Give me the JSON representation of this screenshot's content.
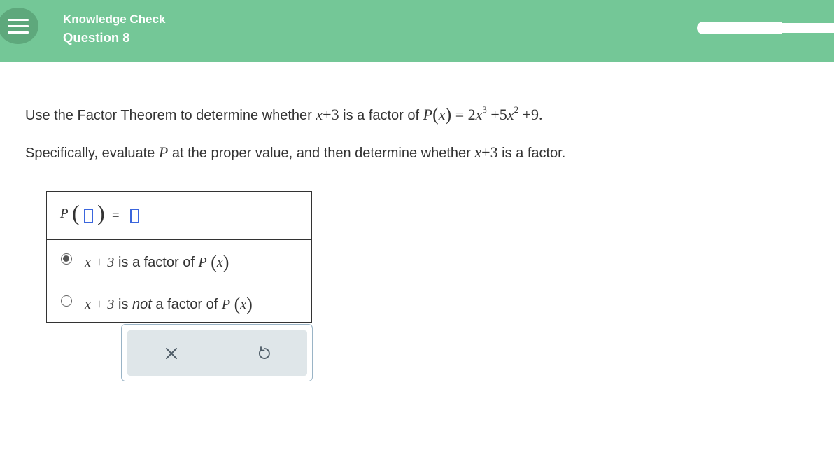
{
  "header": {
    "section": "Knowledge Check",
    "question": "Question 8",
    "menu_icon": "hamburger-icon",
    "progress_fraction": 0.55
  },
  "question": {
    "line1_prefix": "Use the Factor Theorem to determine whether",
    "line1_mid": "is a factor of",
    "line2_prefix": "Specifically, evaluate",
    "line2_mid": "at the proper value, and then determine whether",
    "line2_suffix": "is a factor.",
    "binomial_var": "x",
    "binomial_rest": "+3",
    "poly_name": "P",
    "poly_arg": "x",
    "poly_eq": "= 2",
    "poly_rest1": "+5",
    "poly_rest2": "+9.",
    "exp3": "3",
    "exp2": "2",
    "period": "."
  },
  "answer": {
    "func_name": "P",
    "equals": "=",
    "input_value_1": "",
    "input_value_2": "",
    "options": [
      {
        "binomial": "x + 3",
        "text_pre": "is a factor of",
        "emph": "",
        "text_post": "",
        "selected": true
      },
      {
        "binomial": "x + 3",
        "text_pre": "is",
        "emph": "not",
        "text_post": "a factor of",
        "selected": false
      }
    ],
    "func_label": "P",
    "func_arg": "x"
  },
  "toolbar": {
    "clear_icon": "close-icon",
    "undo_icon": "undo-icon"
  },
  "colors": {
    "header_bg": "#74c797",
    "input_border": "#3b66dd",
    "toolbar_bg": "#dfe6e9"
  }
}
